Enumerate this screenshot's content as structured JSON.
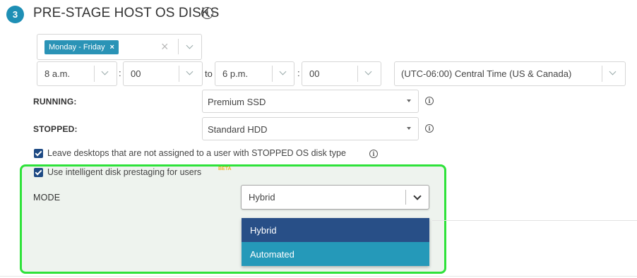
{
  "section": {
    "step_number": "3",
    "title": "PRE-STAGE HOST OS DISKS",
    "info_glyph": "i"
  },
  "days": {
    "tag_label": "Monday - Friday",
    "tag_remove": "×",
    "clear": "×"
  },
  "schedule": {
    "start_hour": "8 a.m.",
    "colon": ":",
    "start_minute": "00",
    "to": "to",
    "end_hour": "6 p.m.",
    "end_minute": "00",
    "timezone": "(UTC-06:00) Central Time (US & Canada)"
  },
  "running": {
    "label": "RUNNING:",
    "value": "Premium SSD"
  },
  "stopped": {
    "label": "STOPPED:",
    "value": "Standard HDD"
  },
  "checkbox_leave": {
    "label": "Leave desktops that are not assigned to a user with STOPPED OS disk type",
    "checked": true
  },
  "checkbox_intelligent": {
    "label": "Use intelligent disk prestaging for users",
    "badge": "BETA",
    "checked": true
  },
  "mode": {
    "label": "MODE",
    "value": "Hybrid",
    "options": [
      "Hybrid",
      "Automated"
    ]
  },
  "colors": {
    "accent": "#1e8fb5",
    "highlight_border": "#2ee23a",
    "option_selected": "#284f87",
    "option_hover": "#2599b9"
  }
}
